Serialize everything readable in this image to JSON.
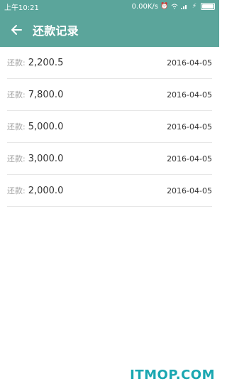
{
  "status": {
    "time": "上午10:21",
    "speed": "0.00K/s"
  },
  "header": {
    "title": "还款记录"
  },
  "records": [
    {
      "label": "还款:",
      "amount": "2,200.5",
      "date": "2016-04-05"
    },
    {
      "label": "还款:",
      "amount": "7,800.0",
      "date": "2016-04-05"
    },
    {
      "label": "还款:",
      "amount": "5,000.0",
      "date": "2016-04-05"
    },
    {
      "label": "还款:",
      "amount": "3,000.0",
      "date": "2016-04-05"
    },
    {
      "label": "还款:",
      "amount": "2,000.0",
      "date": "2016-04-05"
    }
  ],
  "watermark": "ITMOP.COM",
  "colors": {
    "accent": "#5ba59b",
    "watermark": "#1aa7b1"
  },
  "icons": {
    "back": "arrow-left-icon",
    "alarm": "alarm-icon",
    "wifi": "wifi-icon",
    "signal": "signal-icon",
    "charging": "charging-icon",
    "battery": "battery-icon"
  }
}
